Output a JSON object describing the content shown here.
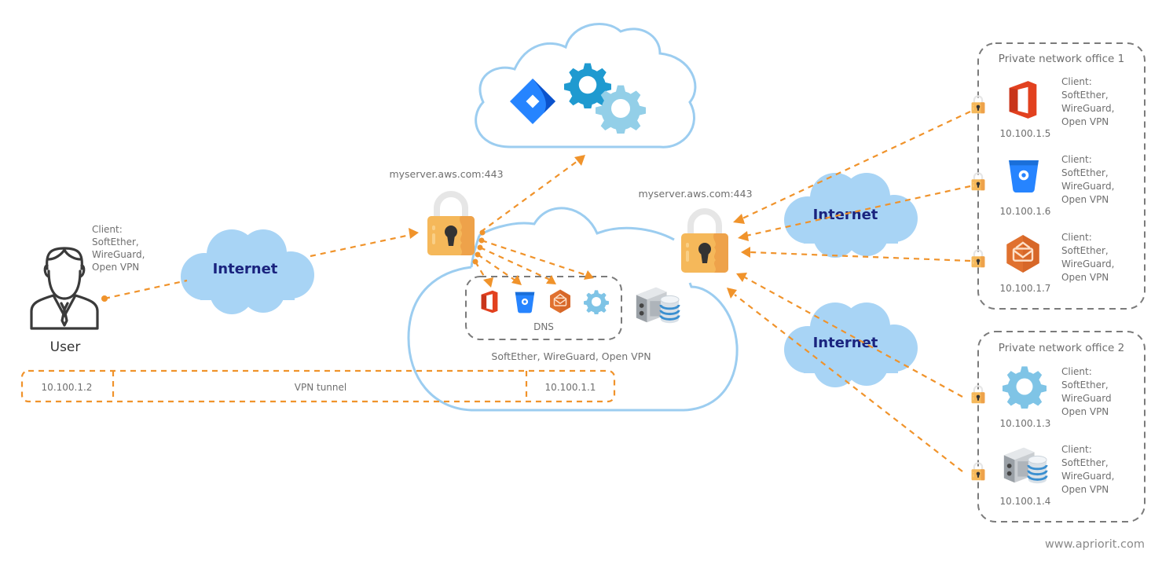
{
  "colors": {
    "connector": "#f0932b",
    "cloud_fill": "#a8d4f5",
    "cloud_outline": "#9ccdf0",
    "internet_text": "#1a237e",
    "lock_body": "#f5b85a",
    "office_red": "#e2411f",
    "bitbucket_blue": "#2684ff",
    "mail_orange": "#e0712f",
    "gear_light": "#7fc4e6",
    "jira_blue": "#2684ff",
    "gear_dark": "#1f8ec8"
  },
  "user": {
    "label": "User",
    "client_lines": [
      "Client:",
      "SoftEther,",
      "WireGuard,",
      "Open VPN"
    ],
    "icon": "user-icon"
  },
  "internet_clouds": [
    {
      "id": "left",
      "label": "Internet"
    },
    {
      "id": "right-top",
      "label": "Internet"
    },
    {
      "id": "right-bottom",
      "label": "Internet"
    }
  ],
  "servers": {
    "left_lock_label": "myserver.aws.com:443",
    "right_lock_label": "myserver.aws.com:443"
  },
  "top_cloud": {
    "icons": [
      "jira-icon",
      "gears-dark-icon",
      "gear-light-icon"
    ]
  },
  "aws_cloud": {
    "dns_label": "DNS",
    "dns_icons": [
      "office-icon",
      "bitbucket-icon",
      "mail-icon",
      "gear-icon"
    ],
    "server_icon": "server-database-icon",
    "protocols_label": "SoftEther, WireGuard, Open VPN"
  },
  "vpn_tunnel": {
    "left_ip": "10.100.1.2",
    "label": "VPN tunnel",
    "right_ip": "10.100.1.1"
  },
  "offices": [
    {
      "title": "Private network office 1",
      "clients": [
        {
          "icon": "office-icon",
          "ip": "10.100.1.5",
          "client_lines": [
            "Client:",
            "SoftEther,",
            "WireGuard,",
            "Open VPN"
          ]
        },
        {
          "icon": "bitbucket-icon",
          "ip": "10.100.1.6",
          "client_lines": [
            "Client:",
            "SoftEther,",
            "WireGuard,",
            "Open VPN"
          ]
        },
        {
          "icon": "mail-icon",
          "ip": "10.100.1.7",
          "client_lines": [
            "Client:",
            "SoftEther,",
            "WireGuard,",
            "Open VPN"
          ]
        }
      ]
    },
    {
      "title": "Private network office 2",
      "clients": [
        {
          "icon": "gear-icon",
          "ip": "10.100.1.3",
          "client_lines": [
            "Client:",
            "SoftEther,",
            "WireGuard",
            "Open VPN"
          ]
        },
        {
          "icon": "server-database-icon",
          "ip": "10.100.1.4",
          "client_lines": [
            "Client:",
            "SoftEther,",
            "WireGuard,",
            "Open VPN"
          ]
        }
      ]
    }
  ],
  "footer": {
    "website": "www.apriorit.com"
  }
}
